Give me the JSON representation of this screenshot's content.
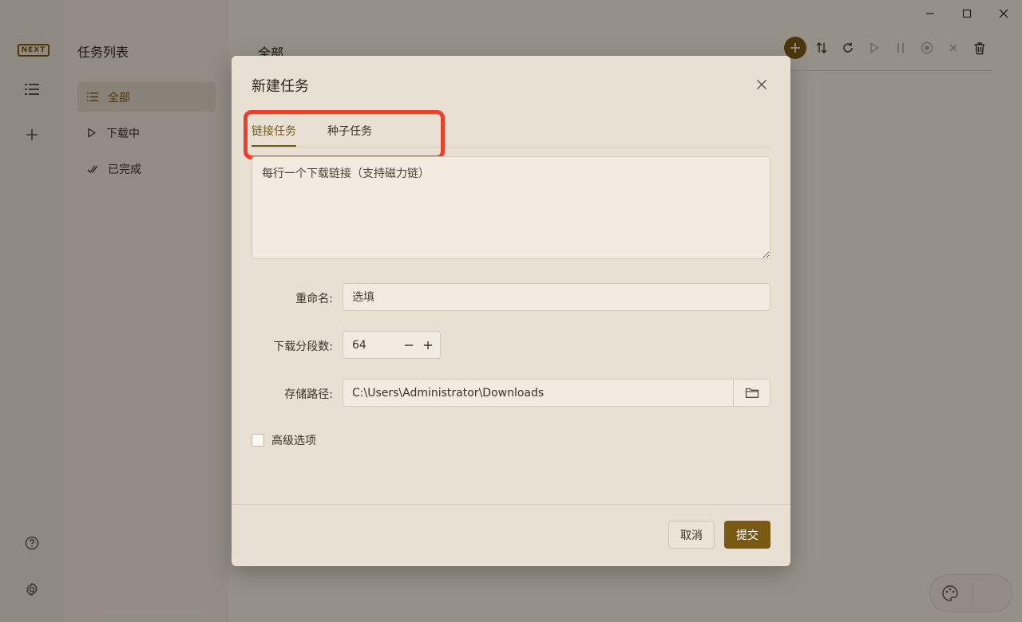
{
  "app": {
    "logo_text": "NEXT",
    "rail": {
      "list_icon": "list-icon",
      "add_icon": "plus-icon",
      "help_icon": "help-circle-icon",
      "settings_icon": "gear-icon"
    }
  },
  "tasks_pane": {
    "title": "任务列表",
    "items": [
      {
        "label": "全部",
        "icon": "list-icon",
        "active": true
      },
      {
        "label": "下载中",
        "icon": "play-icon",
        "active": false
      },
      {
        "label": "已完成",
        "icon": "double-check-icon",
        "active": false
      }
    ]
  },
  "main": {
    "title": "全部",
    "toolbar": [
      "plus-icon",
      "sort-icon",
      "refresh-icon",
      "play-icon",
      "pause-icon",
      "stop-icon",
      "close-icon",
      "trash-icon"
    ]
  },
  "dialog": {
    "title": "新建任务",
    "tabs": [
      {
        "label": "链接任务",
        "active": true
      },
      {
        "label": "种子任务",
        "active": false
      }
    ],
    "links_placeholder": "每行一个下载链接（支持磁力链）",
    "rename_label": "重命名:",
    "rename_placeholder": "选填",
    "segments_label": "下载分段数:",
    "segments_value": "64",
    "path_label": "存储路径:",
    "path_value": "C:\\Users\\Administrator\\Downloads",
    "advanced_label": "高级选项",
    "cancel_label": "取消",
    "submit_label": "提交"
  },
  "colors": {
    "accent": "#7a5a12",
    "highlight_box": "#e8402a"
  }
}
